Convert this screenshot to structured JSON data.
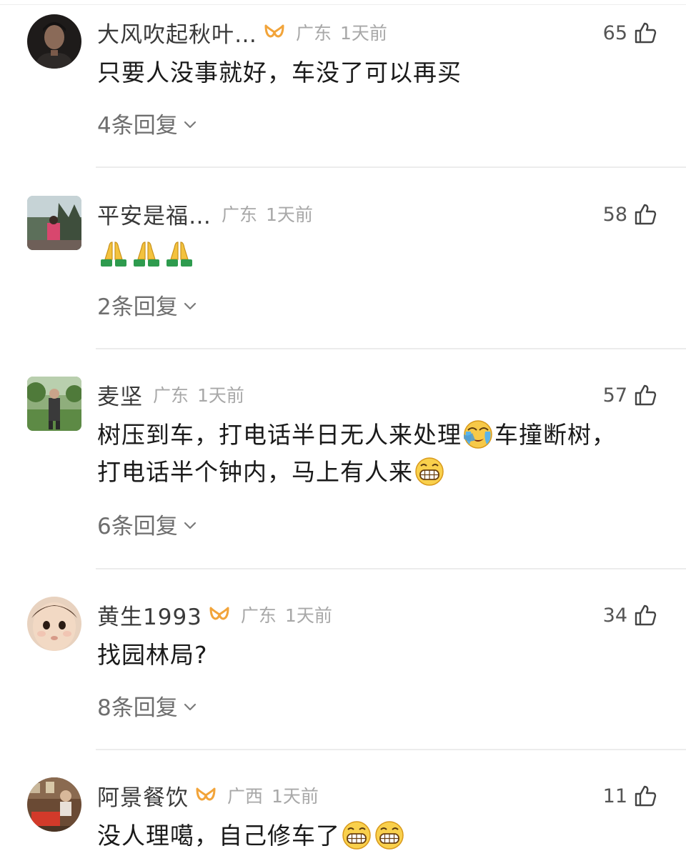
{
  "comments": [
    {
      "username": "大风吹起秋叶…",
      "location": "广东",
      "time": "1天前",
      "likes": "65",
      "text": "只要人没事就好，车没了可以再买",
      "replies": "4条回复"
    },
    {
      "username": "平安是福…",
      "location": "广东",
      "time": "1天前",
      "likes": "58",
      "replies": "2条回复"
    },
    {
      "username": "麦坚",
      "location": "广东",
      "time": "1天前",
      "likes": "57",
      "text_line1_a": "树压到车，打电话半日无人来处理",
      "text_line1_b": "车撞断树，",
      "text_line2": "打电话半个钟内，马上有人来",
      "replies": "6条回复"
    },
    {
      "username": "黄生1993",
      "location": "广东",
      "time": "1天前",
      "likes": "34",
      "text": "找园林局?",
      "replies": "8条回复"
    },
    {
      "username": "阿景餐饮",
      "location": "广西",
      "time": "1天前",
      "likes": "11",
      "text": "没人理噶，自己修车了"
    }
  ],
  "icons": {
    "vip_badge": "vip-badge-icon",
    "like": "thumbs-up-icon",
    "expand": "chevron-down-icon",
    "pray": "pray-emoji",
    "grin": "grin-emoji",
    "crying": "crying-emoji"
  },
  "colors": {
    "vip_badge": "#f2a43a",
    "meta_text": "#a8a8a8",
    "replies_text": "#6e6e6e",
    "divider": "#ececec"
  }
}
